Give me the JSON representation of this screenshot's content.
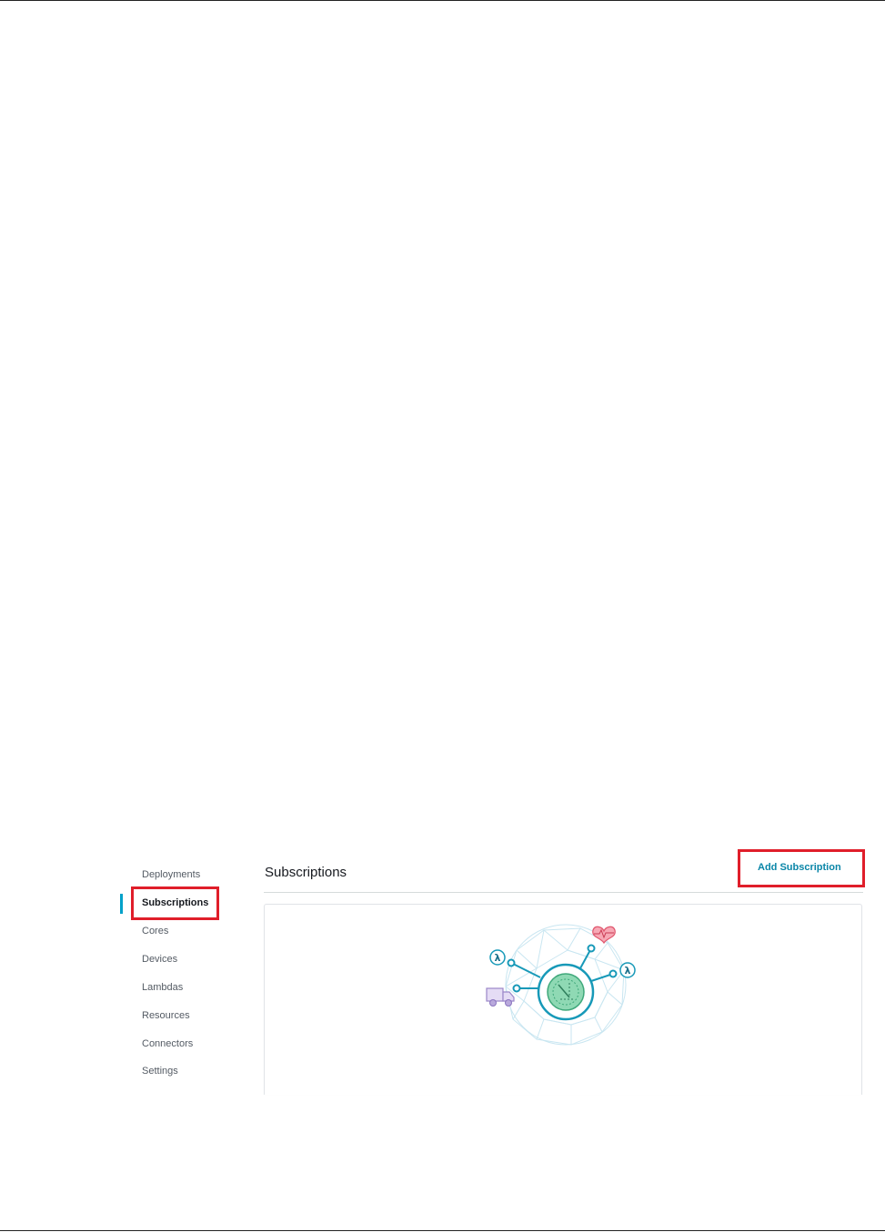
{
  "nav": {
    "items": [
      {
        "label": "Deployments",
        "active": false
      },
      {
        "label": "Subscriptions",
        "active": true
      },
      {
        "label": "Cores",
        "active": false
      },
      {
        "label": "Devices",
        "active": false
      },
      {
        "label": "Lambdas",
        "active": false
      },
      {
        "label": "Resources",
        "active": false
      },
      {
        "label": "Connectors",
        "active": false
      },
      {
        "label": "Settings",
        "active": false
      }
    ]
  },
  "header": {
    "title": "Subscriptions",
    "add_button_label": "Add Subscription"
  },
  "illustration": {
    "icons": [
      "lambda-icon",
      "lambda-icon",
      "heart-monitor-icon",
      "truck-icon",
      "hub-icon"
    ]
  },
  "colors": {
    "accent": "#00a1c9",
    "highlight": "#e01e2a",
    "hub_green": "#7dd3a8",
    "heart": "#f06b7f",
    "truck": "#b9a9dc"
  }
}
